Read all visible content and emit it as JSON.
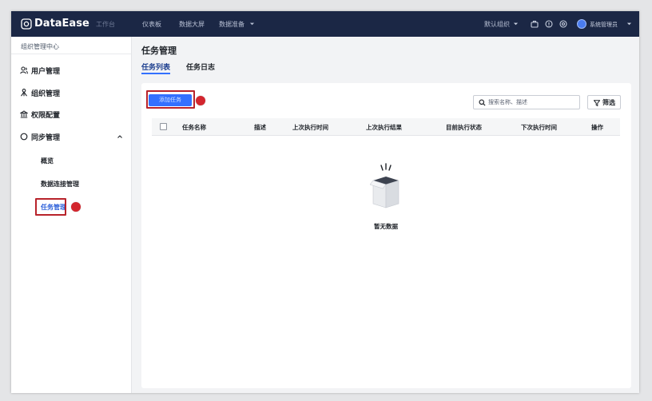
{
  "colors": {
    "header_bg": "#1b2745",
    "accent": "#3370ff",
    "annotation": "#d3262e",
    "main_bg": "#f2f3f5"
  },
  "header": {
    "brand": "DataEase",
    "nav": [
      "工作台",
      "仪表板",
      "数据大屏",
      "数据准备"
    ],
    "org": "默认组织",
    "user": "系统管理员",
    "icons": [
      "briefcase-icon",
      "help-icon",
      "settings-icon"
    ]
  },
  "sidebar": {
    "title": "组织管理中心",
    "items": [
      {
        "label": "用户管理",
        "icon": "user-icon"
      },
      {
        "label": "组织管理",
        "icon": "org-icon"
      },
      {
        "label": "权限配置",
        "icon": "permission-icon"
      },
      {
        "label": "同步管理",
        "icon": "sync-icon",
        "expanded": true
      }
    ],
    "sub_items": [
      {
        "label": "概览"
      },
      {
        "label": "数据连接管理"
      },
      {
        "label": "任务管理",
        "active": true
      }
    ]
  },
  "page": {
    "title": "任务管理",
    "tabs": [
      {
        "label": "任务列表",
        "active": true
      },
      {
        "label": "任务日志",
        "active": false
      }
    ],
    "add_button": "添加任务",
    "search": {
      "placeholder": "搜索名称、描述",
      "value": ""
    },
    "filter": "筛选",
    "table": {
      "columns": [
        "任务名称",
        "描述",
        "上次执行时间",
        "上次执行结果",
        "目前执行状态",
        "下次执行时间",
        "操作"
      ],
      "rows": []
    },
    "empty_text": "暂无数据"
  }
}
